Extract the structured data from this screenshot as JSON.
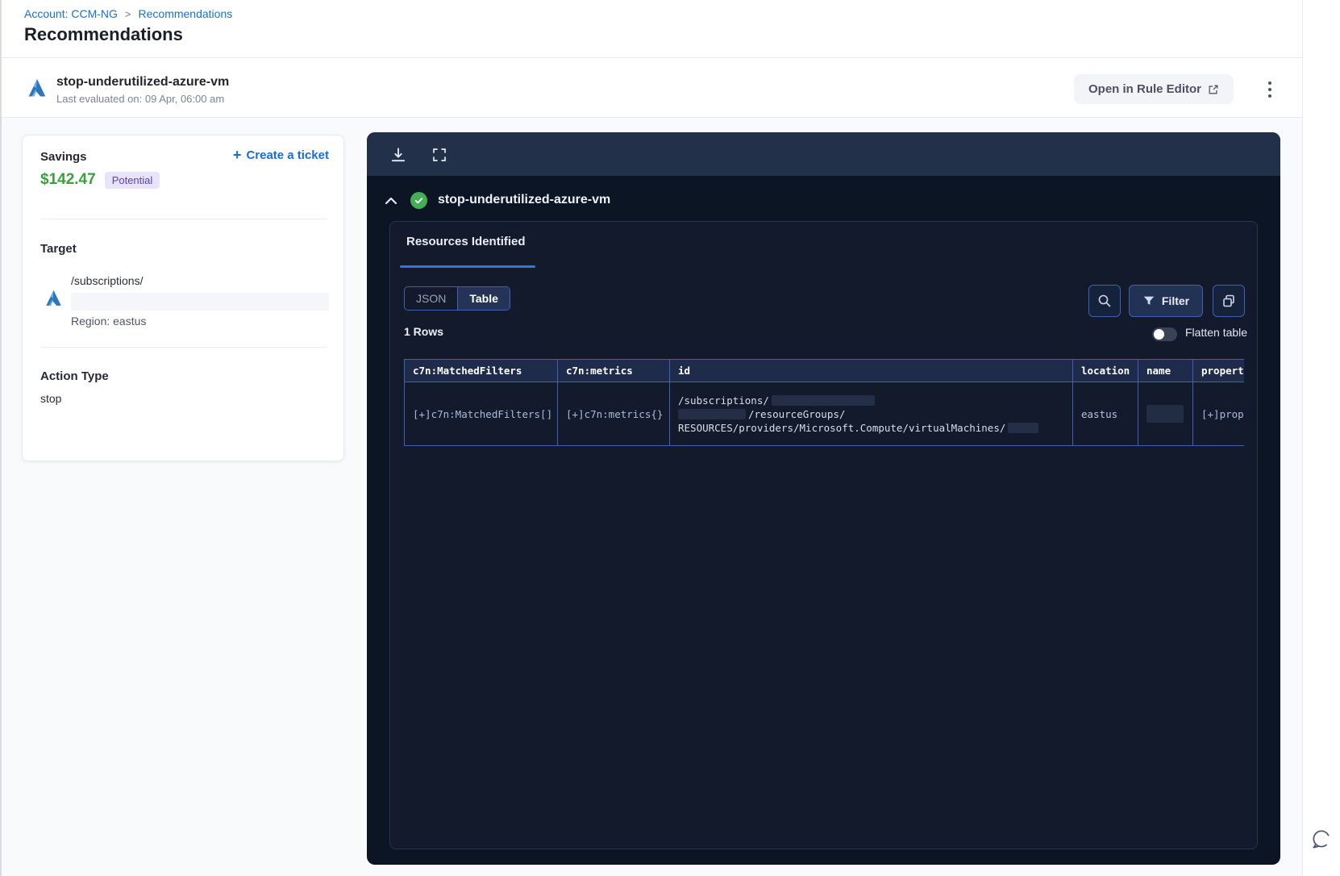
{
  "breadcrumb": {
    "account": "Account: CCM-NG",
    "separator": ">",
    "page": "Recommendations"
  },
  "page": {
    "title": "Recommendations"
  },
  "rule_header": {
    "name": "stop-underutilized-azure-vm",
    "last_evaluated": "Last evaluated on: 09 Apr, 06:00 am",
    "open_button_label": "Open in Rule Editor"
  },
  "summary_card": {
    "savings_label": "Savings",
    "savings_value": "$142.47",
    "savings_badge": "Potential",
    "create_ticket_plus": "+",
    "create_ticket_label": "Create a ticket",
    "target_label": "Target",
    "target_path": "/subscriptions/",
    "target_region": "Region: eastus",
    "action_type_label": "Action Type",
    "action_type_value": "stop"
  },
  "results_panel": {
    "rule_name": "stop-underutilized-azure-vm",
    "tab_label": "Resources Identified",
    "view_toggle": {
      "json_label": "JSON",
      "table_label": "Table",
      "selected": "Table"
    },
    "filter_button_label": "Filter",
    "rows_count": "1 Rows",
    "flatten_label": "Flatten table",
    "flatten_on": false,
    "table": {
      "columns": [
        "c7n:MatchedFilters",
        "c7n:metrics",
        "id",
        "location",
        "name",
        "propert"
      ],
      "rows": [
        {
          "matched_filters": "[+]c7n:MatchedFilters[]",
          "metrics": "[+]c7n:metrics{}",
          "id_line_1": "/subscriptions/",
          "id_line_2": "/resourceGroups/",
          "id_line_3": "RESOURCES/providers/Microsoft.Compute/virtualMachines/",
          "location": "eastus",
          "name": "",
          "properties": "[+]prop"
        }
      ]
    }
  },
  "icons": {
    "top_left_logo": "azure-icon",
    "toolbar": [
      "download-icon",
      "fullscreen-icon"
    ],
    "status": "check-circle-icon",
    "controls": [
      "search-icon",
      "filter-funnel-icon",
      "copy-icon"
    ],
    "floating": "chat-bubble-icon",
    "menu": "kebab-menu-icon"
  },
  "colors": {
    "link_blue": "#1a6fd4",
    "accent_blue": "#3a72e6",
    "savings_green": "#38a13c",
    "badge_bg": "#e7e4fb",
    "badge_text": "#5b40bf",
    "panel_bg": "#0c1523",
    "panel_toolbar_bg": "#233049",
    "inner_card_bg": "#121a2c",
    "table_border": "#3e61b3",
    "table_header_bg": "#1e2b4a",
    "success_green": "#43ae55"
  }
}
